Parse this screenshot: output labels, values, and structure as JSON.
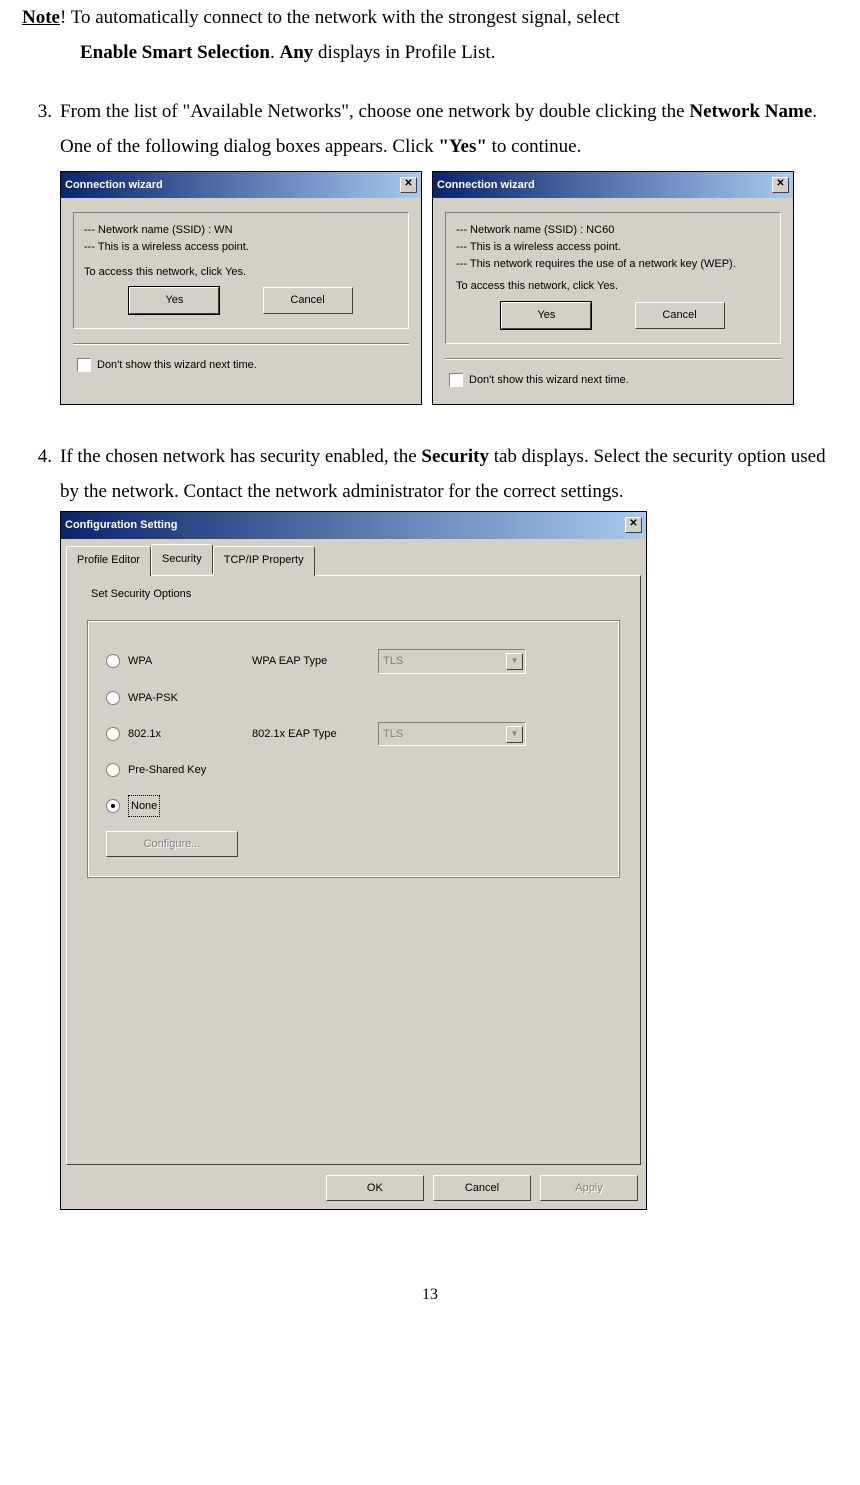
{
  "note": {
    "prefix": "Note",
    "text_line1": "! To automatically connect to the network with the strongest signal, select",
    "bold1": "Enable Smart Selection",
    "mid": ". ",
    "bold2": "Any",
    "tail": " displays in Profile List."
  },
  "step3": {
    "num": "3.",
    "t1": "From the list of \"Available Networks\", choose one network by double clicking the ",
    "b1": "Network Name",
    "t2": ".    One of the following dialog boxes appears.    Click ",
    "b2": "\"Yes\"",
    "t3": " to continue."
  },
  "cw1": {
    "title": "Connection wizard",
    "l1": "--- Network name (SSID) : WN",
    "l2": "--- This is a wireless access point.",
    "l3": "To access this network, click Yes.",
    "yes": "Yes",
    "cancel": "Cancel",
    "chk": "Don't show this wizard next time."
  },
  "cw2": {
    "title": "Connection wizard",
    "l1": "--- Network name (SSID) : NC60",
    "l2": "--- This is a wireless access point.",
    "l3": "--- This network requires the use of a network key (WEP).",
    "l4": "To access this network, click Yes.",
    "yes": "Yes",
    "cancel": "Cancel",
    "chk": "Don't show this wizard next time."
  },
  "step4": {
    "num": "4.",
    "t1": "If the chosen network has security enabled, the ",
    "b1": "Security",
    "t2": " tab displays. Select the security option used by the network. Contact the network administrator for the correct settings."
  },
  "cfg": {
    "title": "Configuration Setting",
    "tabs": {
      "t1": "Profile Editor",
      "t2": "Security",
      "t3": "TCP/IP Property"
    },
    "group": "Set Security Options",
    "opts": {
      "wpa": "WPA",
      "wpapsk": "WPA-PSK",
      "dot1x": "802.1x",
      "psk": "Pre-Shared Key",
      "none": "None"
    },
    "eap1_label": "WPA EAP Type",
    "eap2_label": "802.1x EAP Type",
    "eap_value": "TLS",
    "configure": "Configure...",
    "ok": "OK",
    "cancel": "Cancel",
    "apply": "Apply"
  },
  "pagenum": "13"
}
